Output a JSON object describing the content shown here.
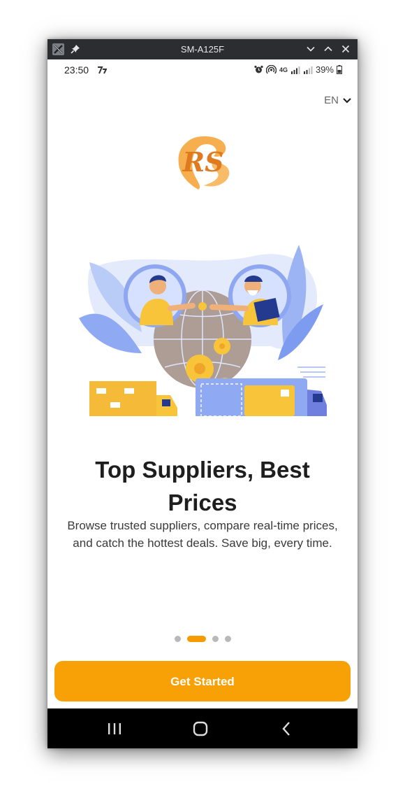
{
  "window": {
    "title": "SM-A125F"
  },
  "status_bar": {
    "time": "23:50",
    "network": "4G",
    "battery": "39%"
  },
  "language": {
    "current": "EN"
  },
  "logo": {
    "text": "RS",
    "color": "#f3a53a"
  },
  "onboarding": {
    "title": "Top Suppliers, Best Prices",
    "description": "Browse trusted suppliers, compare real-time prices, and catch the hottest deals. Save big, every time.",
    "pages_total": 4,
    "active_page": 2
  },
  "cta": {
    "label": "Get Started"
  },
  "colors": {
    "accent": "#f8a107",
    "dot_inactive": "#b9b9b9",
    "illustration_blue": "#7d9cf0",
    "illustration_yellow": "#f8c43a"
  }
}
